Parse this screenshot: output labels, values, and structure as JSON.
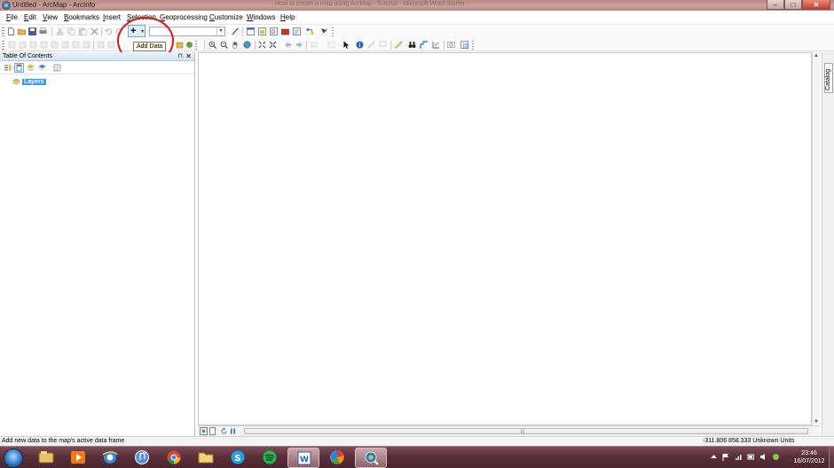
{
  "window": {
    "title": "Untitled - ArcMap - ArcInfo",
    "ghost_text": "How to create a map using ArcMap - Tutorial - Microsoft Word Starter",
    "controls": {
      "minimize": "–",
      "maximize": "□",
      "close": "✕"
    }
  },
  "menu": [
    "File",
    "Edit",
    "View",
    "Bookmarks",
    "Insert",
    "Selection",
    "Geoprocessing",
    "Customize",
    "Windows",
    "Help"
  ],
  "toolbar": {
    "add_data_symbol": "+",
    "add_data_dropdown": "▾",
    "tooltip": "Add Data",
    "scale_value": "",
    "scale_dropdown": "▾"
  },
  "toc": {
    "title": "Table Of Contents",
    "pin": "⊓",
    "close": "✕",
    "layers_label": "Layers"
  },
  "catalog": {
    "label": "Catalog"
  },
  "scroll": {
    "up": "▲",
    "down": "▼",
    "grip": "|||"
  },
  "status": {
    "message": "Add new data to the map's active data frame",
    "coordinates": "-311.806  858.333 Unknown Units"
  },
  "taskbar": {
    "time": "23:46",
    "date": "16/07/2012",
    "apps": [
      "explorer",
      "media-player",
      "internet-explorer",
      "itunes",
      "chrome",
      "folder",
      "skype",
      "spotify",
      "word",
      "picasa",
      "arcmap"
    ]
  },
  "colors": {
    "highlight_circle": "#d51818",
    "selection": "#3399ff",
    "taskbar": "#5a303a"
  }
}
